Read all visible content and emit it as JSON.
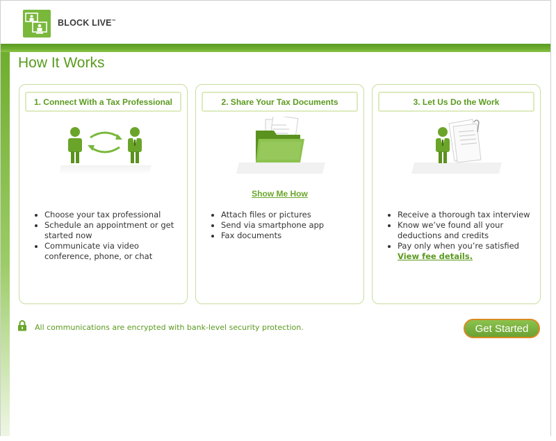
{
  "brand": {
    "name": "BLOCK LIVE",
    "tm": "™",
    "color": "#7ab83c"
  },
  "page": {
    "title": "How It Works"
  },
  "cards": [
    {
      "heading": "1. Connect With a Tax Professional",
      "icon": "people-exchange-icon",
      "bullets": [
        "Choose your tax professional",
        "Schedule an appointment or get started now",
        "Communicate via video conference, phone, or chat"
      ]
    },
    {
      "heading": "2. Share Your Tax Documents",
      "icon": "document-folder-icon",
      "link": "Show Me How",
      "bullets": [
        "Attach files or pictures",
        "Send via smartphone app",
        "Fax documents"
      ]
    },
    {
      "heading": "3. Let Us Do the Work",
      "icon": "person-documents-icon",
      "bullets": [
        "Receive a thorough tax interview",
        "Know we’ve found all your deductions and credits",
        "Pay only when you’re satisfied"
      ],
      "link": "View fee details."
    }
  ],
  "security": {
    "icon": "lock-icon",
    "text": "All communications are encrypted with bank-level security protection."
  },
  "cta": {
    "label": "Get Started",
    "accent": "#d98a22"
  }
}
